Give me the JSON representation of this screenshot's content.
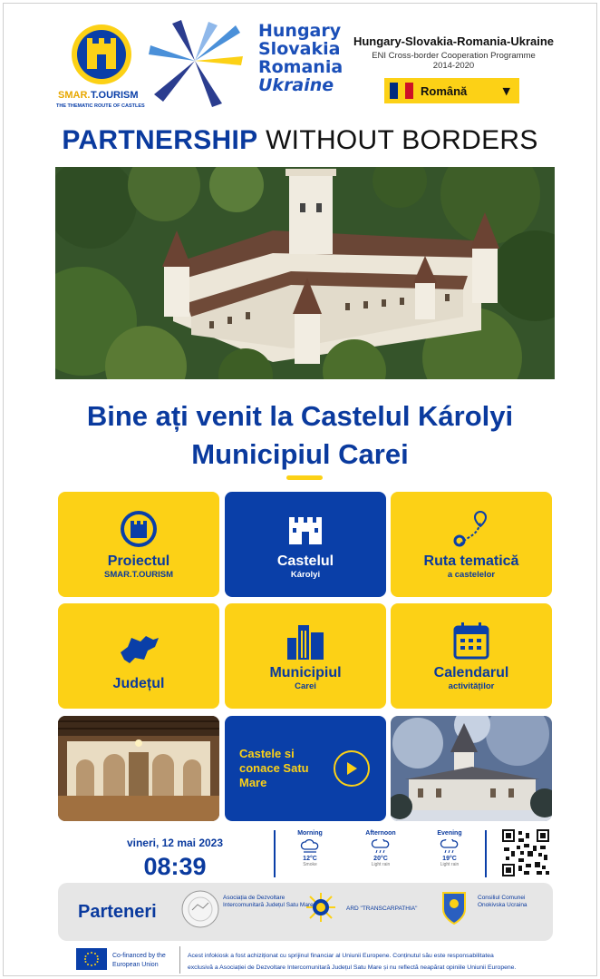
{
  "header": {
    "logo_primary": "SMAR.T.OURISM",
    "logo_primary_sub": "THE THEMATIC ROUTE OF CASTLES",
    "logo_words": [
      "Hungary",
      "Slovakia",
      "Romania",
      "Ukraine"
    ],
    "programme_title": "Hungary-Slovakia-Romania-Ukraine",
    "programme_sub_1": "ENI Cross-border Cooperation Programme",
    "programme_sub_2": "2014-2020",
    "language": "Română"
  },
  "tagline": {
    "bold": "PARTNERSHIP",
    "light": "WITHOUT BORDERS"
  },
  "welcome": {
    "line1": "Bine ați venit la Castelul Károlyi",
    "line2": "Municipiul Carei"
  },
  "tiles": [
    {
      "title": "Proiectul",
      "sub": "SMAR.T.OURISM",
      "icon": "castle-logo-icon"
    },
    {
      "title": "Castelul",
      "sub": "Károlyi",
      "icon": "castle-icon"
    },
    {
      "title": "Ruta tematică",
      "sub": "a castelelor",
      "icon": "route-pin-icon"
    },
    {
      "title": "Județul",
      "sub": "",
      "icon": "county-map-icon"
    },
    {
      "title": "Municipiul",
      "sub": "Carei",
      "icon": "city-buildings-icon"
    },
    {
      "title": "Calendarul",
      "sub": "activităților",
      "icon": "calendar-icon"
    }
  ],
  "video_tile": {
    "label": "Castele si conace Satu Mare",
    "icon": "play-icon"
  },
  "info": {
    "date": "vineri, 12 mai 2023",
    "time": "08:39",
    "weather": [
      {
        "label": "Morning",
        "temp": "12°C",
        "desc": "Smoke"
      },
      {
        "label": "Afternoon",
        "temp": "20°C",
        "desc": "Light rain"
      },
      {
        "label": "Evening",
        "temp": "19°C",
        "desc": "Light rain"
      }
    ]
  },
  "partners": {
    "title": "Parteneri",
    "p1": "Asociația de Dezvoltare Intercomunitară Județul Satu Mare",
    "p2": "ARD \"TRANSCARPATHIA\"",
    "p3": "Consiliul Comunei Onokivska Ucraina"
  },
  "footer": {
    "eu_line1": "Co-financed by the",
    "eu_line2": "European Union",
    "disclaimer_1": "Acest infokiosk a fost achiziționat cu sprijinul financiar al Uniunii Europene. Conținutul său este responsabilitatea",
    "disclaimer_2": "exclusivă a Asociației de Dezvoltare Intercomunitară Județul Satu Mare și nu reflectă neapărat opiniile Uniunii Europene."
  },
  "colors": {
    "blue": "#0a3fa8",
    "yellow": "#fcd116",
    "text_blue": "#0a3a9e"
  }
}
